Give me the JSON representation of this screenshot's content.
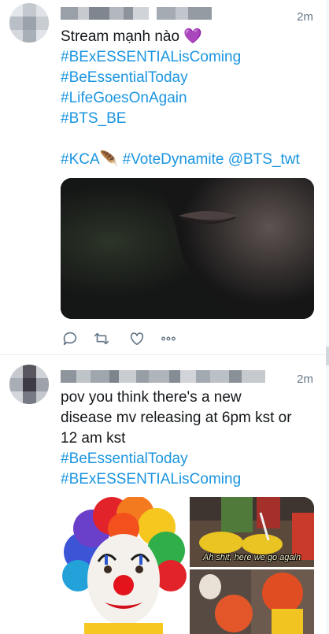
{
  "tweets": [
    {
      "timestamp": "2m",
      "lines": [
        {
          "text": "Stream mạnh nào 💜",
          "type": "text"
        },
        {
          "text": "#BExESSENTIALisComing",
          "type": "hashtag"
        },
        {
          "text": "#BeEssentialToday",
          "type": "hashtag"
        },
        {
          "text": "#LifeGoesOnAgain",
          "type": "hashtag"
        },
        {
          "text": "#BTS_BE",
          "type": "hashtag"
        },
        {
          "text": "",
          "type": "blank"
        },
        {
          "text": "#KCA🪶 #VoteDynamite  @BTS_twt",
          "type": "hashtag"
        }
      ],
      "actions": [
        "reply-icon",
        "retweet-icon",
        "like-icon",
        "more-icon"
      ]
    },
    {
      "timestamp": "2m",
      "lines": [
        {
          "text": "pov you think there's a new",
          "type": "text"
        },
        {
          "text": "disease mv releasing at 6pm kst or",
          "type": "text"
        },
        {
          "text": "12 am kst",
          "type": "text"
        },
        {
          "text": "#BeEssentialToday",
          "type": "hashtag"
        },
        {
          "text": "#BExESSENTIALisComing",
          "type": "hashtag"
        }
      ],
      "media_caption": "Ah shit, here we go again"
    }
  ],
  "colors": {
    "hashtag": "#1b95e0",
    "text": "#14171a",
    "meta": "#657786",
    "divider": "#e6ecf0"
  }
}
